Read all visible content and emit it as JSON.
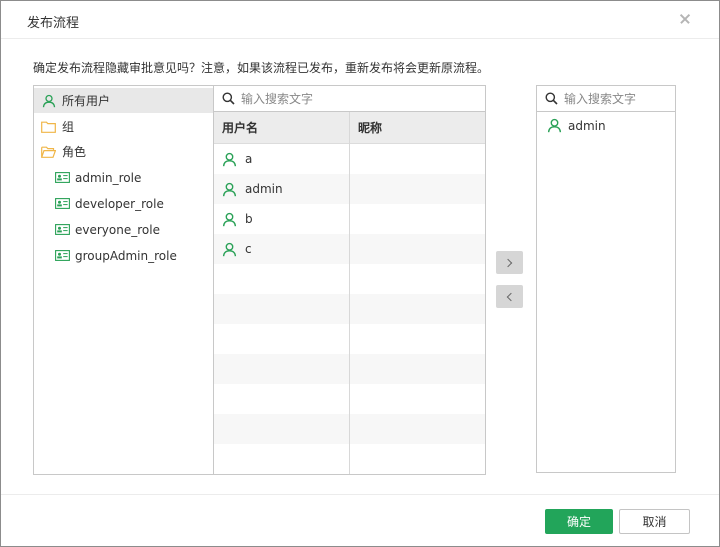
{
  "dialog": {
    "title": "发布流程",
    "message": "确定发布流程隐藏审批意见吗？注意，如果该流程已发布，重新发布将会更新原流程。"
  },
  "tree": {
    "items": [
      {
        "label": "所有用户",
        "icon": "user-icon"
      },
      {
        "label": "组",
        "icon": "folder-icon"
      },
      {
        "label": "角色",
        "icon": "folder-open-icon"
      },
      {
        "label": "admin_role",
        "icon": "role-card-icon"
      },
      {
        "label": "developer_role",
        "icon": "role-card-icon"
      },
      {
        "label": "everyone_role",
        "icon": "role-card-icon"
      },
      {
        "label": "groupAdmin_role",
        "icon": "role-card-icon"
      }
    ]
  },
  "user_table": {
    "search_placeholder": "输入搜索文字",
    "columns": [
      "用户名",
      "昵称"
    ],
    "rows": [
      {
        "username": "a",
        "nickname": ""
      },
      {
        "username": "admin",
        "nickname": ""
      },
      {
        "username": "b",
        "nickname": ""
      },
      {
        "username": "c",
        "nickname": ""
      }
    ]
  },
  "selected": {
    "search_placeholder": "输入搜索文字",
    "items": [
      "admin"
    ]
  },
  "buttons": {
    "ok": "确定",
    "cancel": "取消"
  },
  "colors": {
    "accent": "#22a55a",
    "folder": "#f0b648",
    "icon_green": "#2aa157"
  }
}
